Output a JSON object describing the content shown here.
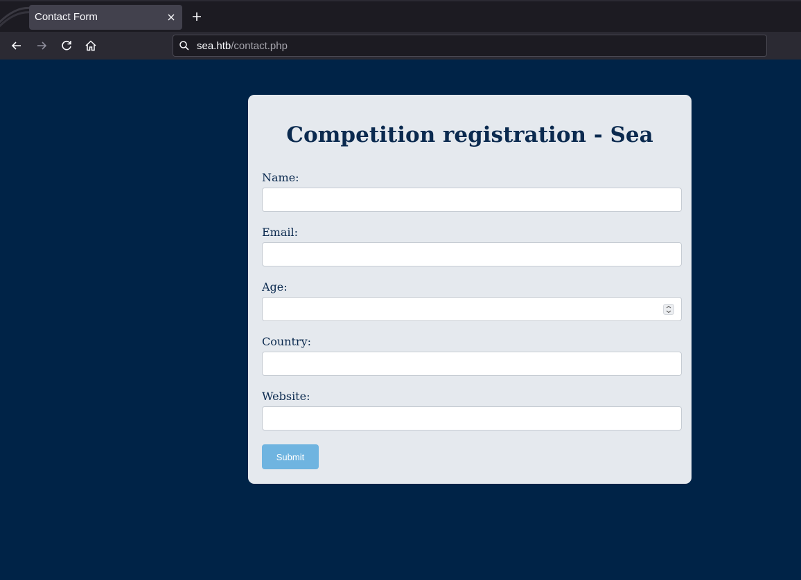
{
  "browser": {
    "tab_title": "Contact Form",
    "url_host": "sea.htb",
    "url_path": "/contact.php"
  },
  "form": {
    "title": "Competition registration - Sea",
    "fields": [
      {
        "label": "Name:",
        "value": ""
      },
      {
        "label": "Email:",
        "value": ""
      },
      {
        "label": "Age:",
        "value": ""
      },
      {
        "label": "Country:",
        "value": ""
      },
      {
        "label": "Website:",
        "value": ""
      }
    ],
    "submit_label": "Submit"
  },
  "colors": {
    "page_background": "#002347",
    "card_background": "#e5e9ee",
    "heading_color": "#0b2a4f",
    "submit_button": "#6fb4e0"
  }
}
